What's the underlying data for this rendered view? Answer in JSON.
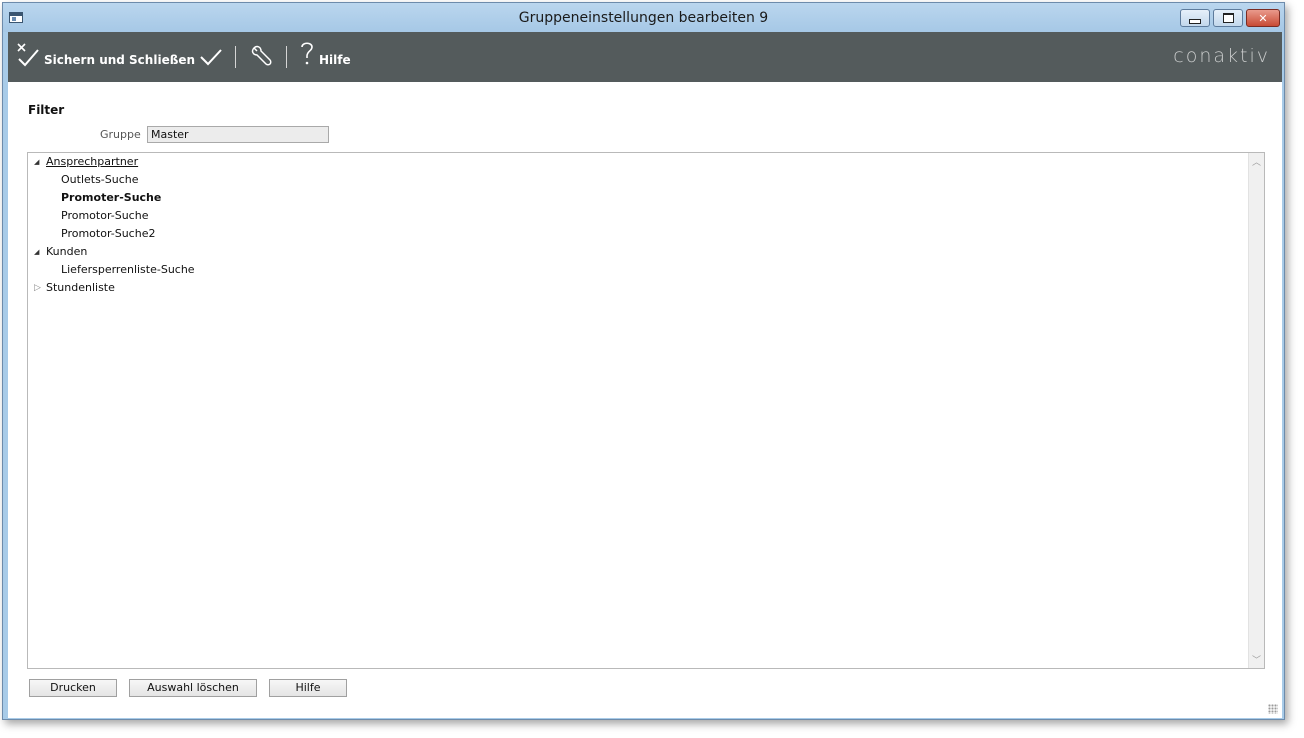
{
  "window": {
    "title": "Gruppeneinstellungen bearbeiten 9",
    "controls": [
      "minimize",
      "maximize",
      "close"
    ]
  },
  "toolbar": {
    "save_close_label": "Sichern und Schließen",
    "help_label": "Hilfe",
    "logo_text": "conaktiv",
    "icons": [
      "save-close-icon",
      "checkmark-icon",
      "wrench-icon",
      "help-icon"
    ]
  },
  "filter": {
    "section_title": "Filter",
    "group_label": "Gruppe",
    "group_value": "Master"
  },
  "tree": {
    "nodes": [
      {
        "label": "Ansprechpartner",
        "level": 0,
        "expanded": true,
        "style": "underline"
      },
      {
        "label": "Outlets-Suche",
        "level": 1,
        "style": "normal"
      },
      {
        "label": "Promoter-Suche",
        "level": 1,
        "style": "bold"
      },
      {
        "label": "Promotor-Suche",
        "level": 1,
        "style": "normal"
      },
      {
        "label": "Promotor-Suche2",
        "level": 1,
        "style": "normal"
      },
      {
        "label": "Kunden",
        "level": 0,
        "expanded": true,
        "style": "normal"
      },
      {
        "label": "Liefersperrenliste-Suche",
        "level": 1,
        "style": "normal"
      },
      {
        "label": "Stundenliste",
        "level": 0,
        "expanded": false,
        "style": "normal"
      }
    ]
  },
  "buttons": {
    "print": "Drucken",
    "clear_selection": "Auswahl löschen",
    "help": "Hilfe"
  },
  "colors": {
    "toolbar_bg": "#545b5c",
    "window_frame": "#a8cbe8",
    "logo": "#c9cbcb"
  }
}
